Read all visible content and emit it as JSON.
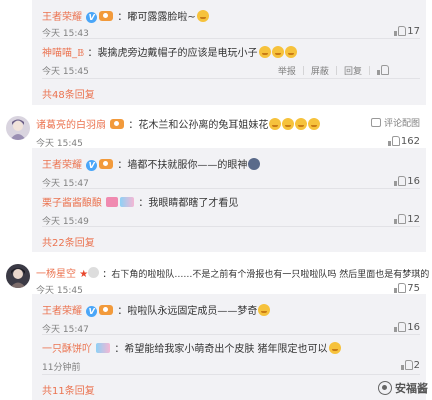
{
  "thread1": {
    "replies": [
      {
        "name": "王者荣耀",
        "text": "：嘟可露露脸啦~",
        "time": "今天 15:43",
        "likes": "17"
      },
      {
        "name": "神喵喵_𝔹",
        "text": "：裴擒虎旁边戴帽子的应该是电玩小子",
        "time": "今天 15:45",
        "actions": {
          "report": "举报",
          "block": "屏蔽",
          "reply": "回复"
        }
      }
    ],
    "more": "共48条回复"
  },
  "comment2": {
    "name": "诸葛亮的白羽扇",
    "text": "：花木兰和公孙离的兔耳姐妹花",
    "time": "今天 15:45",
    "action_reply": "评论配图",
    "likes": "162"
  },
  "thread2": {
    "replies": [
      {
        "name": "王者荣耀",
        "text": "：墙都不扶就服你——的眼神",
        "time": "今天 15:47",
        "likes": "16"
      },
      {
        "name": "栗子酱酱酿酿",
        "text": "：我眼睛都瞎了才看见",
        "time": "今天 15:49",
        "likes": "12"
      }
    ],
    "more": "共22条回复"
  },
  "comment3": {
    "name": "一杨星空",
    "text": "：右下角的啦啦队……不是之前有个滑报也有一只啦啦队吗 然后里面也是有梦琪的",
    "time": "今天 15:45",
    "likes": "75"
  },
  "thread3": {
    "replies": [
      {
        "name": "王者荣耀",
        "text": "：啦啦队永远固定成员——梦奇",
        "time": "今天 15:47",
        "likes": "16"
      },
      {
        "name": "一只酥饼吖",
        "text": "：希望能给我家小萌奇出个皮肤 猪年限定也可以",
        "time": "11分钟前",
        "likes": "2"
      }
    ],
    "more": "共11条回复"
  },
  "watermark": "安福酱",
  "colors": {
    "name_link": "#eb7350",
    "reply_bg": "#f2f2f5",
    "vip_badge": "#4aa6f8"
  }
}
